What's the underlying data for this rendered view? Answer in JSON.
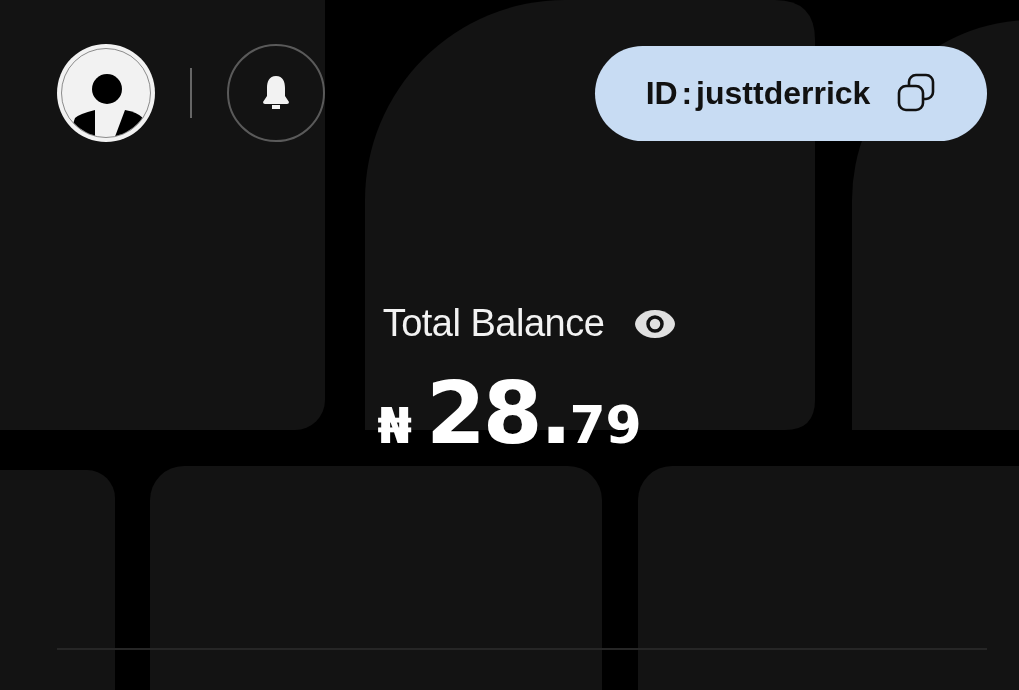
{
  "header": {
    "user_id": "ID : justtderrick"
  },
  "balance": {
    "label": "Total Balance",
    "currency": "₦",
    "whole": "28.",
    "fraction": "79"
  }
}
